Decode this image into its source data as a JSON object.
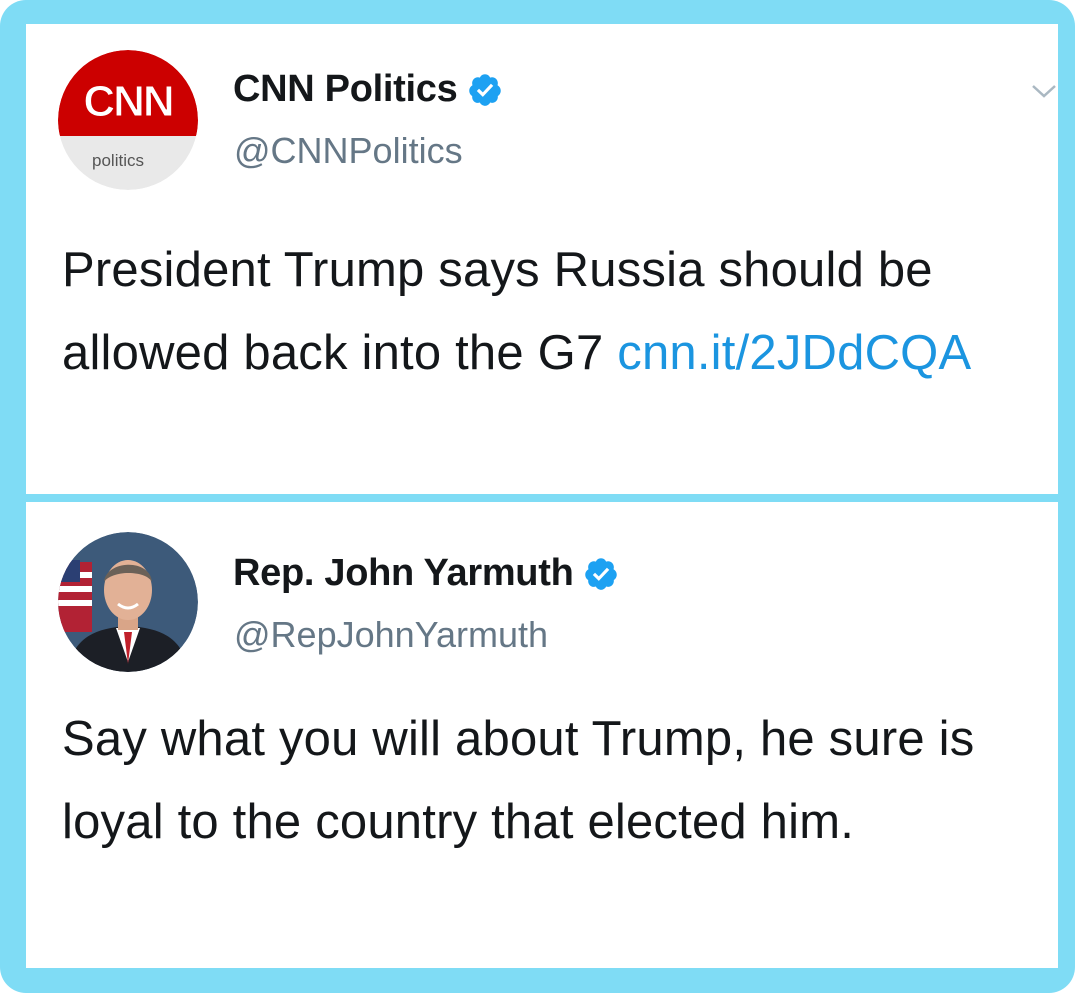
{
  "tweets": [
    {
      "avatar": {
        "icon": "cnn-politics-logo",
        "brand_text": "CNN",
        "sub_text": "politics",
        "brand_color": "#cc0000"
      },
      "display_name": "CNN Politics",
      "verified": true,
      "handle": "@CNNPolitics",
      "text": "President Trump says Russia should be allowed back into the G7",
      "link": "cnn.it/2JDdCQA",
      "menu_icon": "chevron-down-icon"
    },
    {
      "avatar": {
        "icon": "user-photo"
      },
      "display_name": "Rep. John Yarmuth",
      "verified": true,
      "handle": "@RepJohnYarmuth",
      "text": "Say what you will about Trump, he sure is loyal to the country that elected him."
    }
  ],
  "colors": {
    "frame": "#7fdcf5",
    "verified_badge": "#1da1f2",
    "link": "#1b95e0",
    "handle": "#657786",
    "text": "#14171a"
  }
}
